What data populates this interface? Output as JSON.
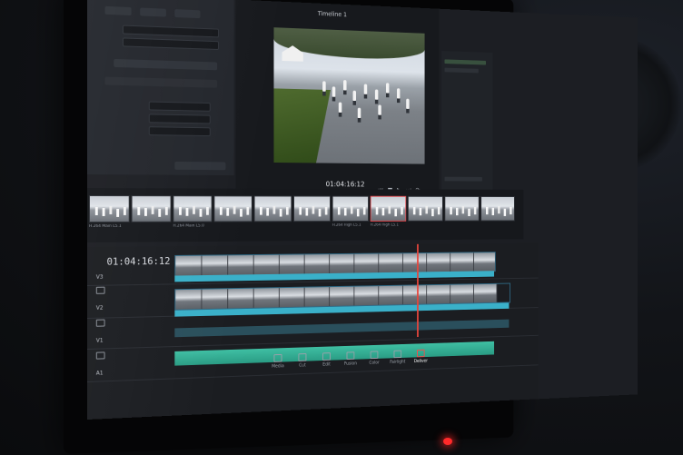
{
  "viewer": {
    "title": "Timeline 1",
    "timecode": "01:04:16:12"
  },
  "timeline": {
    "timecode": "01:04:16:12",
    "tracks": [
      "V3",
      "V2",
      "V1",
      "A1"
    ]
  },
  "clips": [
    "H.264 Main L5.1",
    "H.264 Main L5.0",
    "H.264 High L5.1",
    "H.264 High L5.1"
  ],
  "pages": [
    "Media",
    "Cut",
    "Edit",
    "Fusion",
    "Color",
    "Fairlight",
    "Deliver"
  ],
  "colors": {
    "accent": "#3ab0c9",
    "audio": "#2fb596",
    "playhead": "#e8453c",
    "active_page": "#ff4646"
  }
}
